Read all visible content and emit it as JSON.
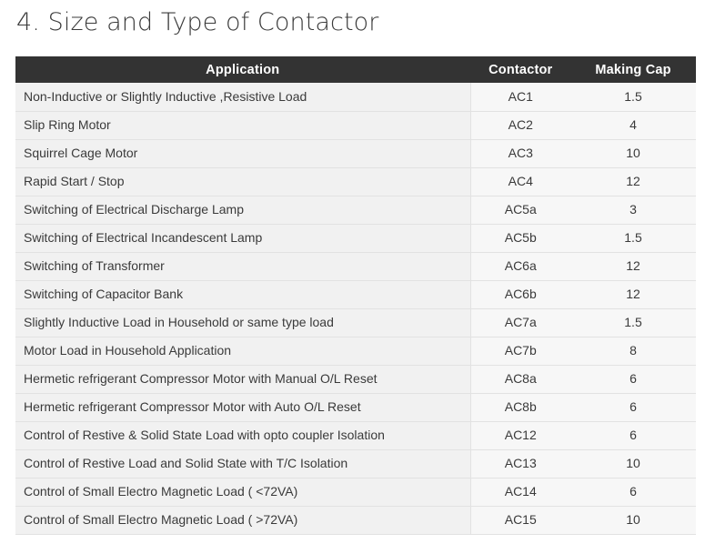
{
  "document": {
    "title": "4. Size and Type of Contactor"
  },
  "table": {
    "headers": {
      "application": "Application",
      "contactor": "Contactor",
      "making_cap": "Making Cap"
    },
    "rows": [
      {
        "application": "Non-Inductive or Slightly Inductive ,Resistive Load",
        "contactor": "AC1",
        "making_cap": "1.5"
      },
      {
        "application": "Slip Ring Motor",
        "contactor": "AC2",
        "making_cap": "4"
      },
      {
        "application": "Squirrel Cage Motor",
        "contactor": "AC3",
        "making_cap": "10"
      },
      {
        "application": "Rapid Start / Stop",
        "contactor": "AC4",
        "making_cap": "12"
      },
      {
        "application": "Switching of Electrical Discharge Lamp",
        "contactor": "AC5a",
        "making_cap": "3"
      },
      {
        "application": "Switching of Electrical Incandescent Lamp",
        "contactor": "AC5b",
        "making_cap": "1.5"
      },
      {
        "application": "Switching of Transformer",
        "contactor": "AC6a",
        "making_cap": "12"
      },
      {
        "application": "Switching of Capacitor Bank",
        "contactor": "AC6b",
        "making_cap": "12"
      },
      {
        "application": "Slightly Inductive Load in Household or same type load",
        "contactor": "AC7a",
        "making_cap": "1.5"
      },
      {
        "application": "Motor Load in Household Application",
        "contactor": "AC7b",
        "making_cap": "8"
      },
      {
        "application": "Hermetic refrigerant Compressor Motor with Manual O/L Reset",
        "contactor": "AC8a",
        "making_cap": "6"
      },
      {
        "application": "Hermetic refrigerant Compressor Motor with Auto O/L Reset",
        "contactor": "AC8b",
        "making_cap": "6"
      },
      {
        "application": "Control of Restive & Solid State Load with opto coupler Isolation",
        "contactor": "AC12",
        "making_cap": "6"
      },
      {
        "application": "Control of Restive Load and Solid State with T/C Isolation",
        "contactor": "AC13",
        "making_cap": "10"
      },
      {
        "application": "Control of Small Electro Magnetic Load ( <72VA)",
        "contactor": "AC14",
        "making_cap": "6"
      },
      {
        "application": "Control of Small Electro Magnetic Load ( >72VA)",
        "contactor": "AC15",
        "making_cap": "10"
      }
    ]
  },
  "colors": {
    "header_bg": "#333333",
    "header_text": "#ffffff",
    "row_bg": "#f7f7f7",
    "row_alt_cell_bg": "#f1f1f1",
    "row_border": "#e2e2e2",
    "body_text": "#3a3a3a",
    "page_bg": "#ffffff",
    "title_text": "#3b3b3b"
  }
}
